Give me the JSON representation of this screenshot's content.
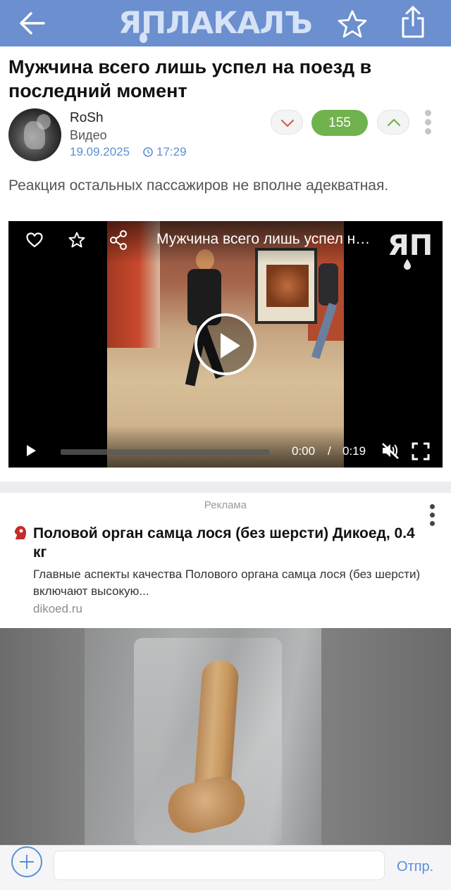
{
  "header": {
    "logo_text": "ЯПЛАКАЛЪ",
    "back_icon": "arrow-left-icon",
    "favorite_icon": "star-outline-icon",
    "share_icon": "share-upload-icon",
    "bar_color": "#6b8fcf"
  },
  "post": {
    "title": "Мужчина всего лишь успел на поезд в последний момент",
    "author": "RoSh",
    "category": "Видео",
    "date": "19.09.2025",
    "time": "17:29",
    "score": "155",
    "description": "Реакция остальных пассажиров не вполне адекватная."
  },
  "video": {
    "title": "Мужчина всего лишь успел на поезд в последний момент",
    "current_time": "0:00",
    "separator": "/",
    "duration": "0:19",
    "logo_text": "ЯП",
    "muted": true,
    "progress": 0
  },
  "ad": {
    "label": "Реклама",
    "title": "Половой орган самца лося (без шерсти) Дикоед, 0.4 кг",
    "text": "Главные аспекты качества Полового органа самца лося (без шерсти) включают высокую...",
    "domain": "dikoed.ru"
  },
  "comment_bar": {
    "placeholder": "",
    "send_label": "Отпр."
  },
  "colors": {
    "accent": "#5a8fd8",
    "score_bg": "#6fb24e",
    "date": "#5f8fd0"
  }
}
